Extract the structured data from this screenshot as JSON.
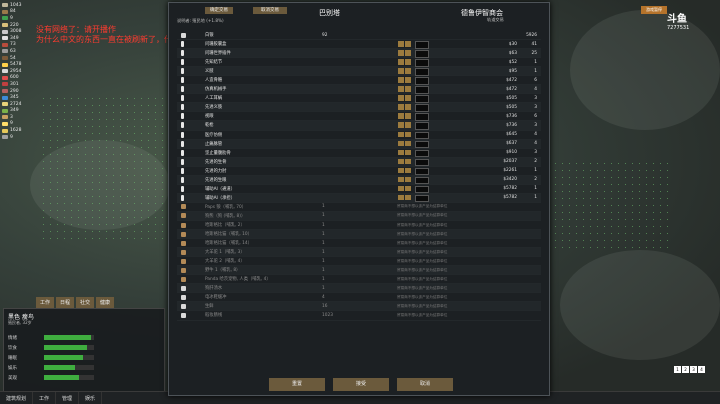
{
  "app": {
    "title": "巴别塔 交易界面"
  },
  "overlay_note": {
    "line1": "没有网络了：请开播作",
    "line2": "为什么中文的东西一直在被刷新了，什么"
  },
  "resources": [
    "1043",
    "84",
    "9",
    "220",
    "3008",
    "349",
    "73",
    "63",
    "54",
    "5478",
    "2954",
    "600",
    "301",
    "290",
    "345",
    "2724",
    "349",
    "3",
    "9",
    "1628",
    "9"
  ],
  "dialog": {
    "btn_left": "确定交易",
    "btn_right": "取消交易",
    "colony_name": "巴别塔",
    "trader_name": "德鲁伊智商会",
    "trader_sub": "轨道交易",
    "info_line": "说明者: 殖民地 (+1.8%)",
    "header_silver": "白银",
    "header_qty_left": "92",
    "header_qty_right": "5926",
    "footer": {
      "reset": "重置",
      "confirm": "接受",
      "cancel": "取消"
    }
  },
  "rows": [
    {
      "name": "问珊胶囊盒",
      "lq": "",
      "price": "$30",
      "rq": "41",
      "type": "gear"
    },
    {
      "name": "问珊世界插件",
      "lq": "",
      "price": "$63",
      "rq": "25",
      "type": "gear"
    },
    {
      "name": "先知结节",
      "lq": "",
      "price": "$52",
      "rq": "1",
      "type": "gear"
    },
    {
      "name": "义肢",
      "lq": "",
      "price": "$95",
      "rq": "1",
      "type": "gear"
    },
    {
      "name": "人造骨骼",
      "lq": "",
      "price": "$472",
      "rq": "6",
      "type": "gear"
    },
    {
      "name": "仿真机械手",
      "lq": "",
      "price": "$472",
      "rq": "4",
      "type": "gear"
    },
    {
      "name": "人工耳蜗",
      "lq": "",
      "price": "$505",
      "rq": "3",
      "type": "gear"
    },
    {
      "name": "先进义肢",
      "lq": "",
      "price": "$505",
      "rq": "3",
      "type": "gear"
    },
    {
      "name": "视眼",
      "lq": "",
      "price": "$736",
      "rq": "6",
      "type": "gear"
    },
    {
      "name": "乾枪",
      "lq": "",
      "price": "$736",
      "rq": "3",
      "type": "gear"
    },
    {
      "name": "医疗仿佣",
      "lq": "",
      "price": "$645",
      "rq": "4",
      "type": "gear"
    },
    {
      "name": "止痛脉管",
      "lq": "",
      "price": "$637",
      "rq": "4",
      "type": "gear"
    },
    {
      "name": "坚止量腹肋骨",
      "lq": "",
      "price": "$910",
      "rq": "3",
      "type": "gear"
    },
    {
      "name": "先进的生骨",
      "lq": "",
      "price": "$2037",
      "rq": "2",
      "type": "gear"
    },
    {
      "name": "先进的力肘",
      "lq": "",
      "price": "$2261",
      "rq": "1",
      "type": "gear"
    },
    {
      "name": "先进的生眼",
      "lq": "",
      "price": "$3420",
      "rq": "2",
      "type": "gear"
    },
    {
      "name": "辅助AI（通道）",
      "lq": "",
      "price": "$5782",
      "rq": "1",
      "type": "gear"
    },
    {
      "name": "辅助AI（承担）",
      "lq": "",
      "price": "$5782",
      "rq": "1",
      "type": "gear"
    },
    {
      "name": "Paps 狼（哺乳, 70）",
      "lq": "1",
      "price": "",
      "rq": "",
      "type": "animal",
      "note": "贸易商不想以该产品为结算单位"
    },
    {
      "name": "狗熊（狗 (哺乳, 8)）",
      "lq": "1",
      "price": "",
      "rq": "",
      "type": "animal",
      "note": "贸易商不想以该产品为结算单位"
    },
    {
      "name": "哈斯格比（哺乳, 2）",
      "lq": "1",
      "price": "",
      "rq": "",
      "type": "animal",
      "note": "贸易商不想以该产品为结算单位"
    },
    {
      "name": "哈斯格比猫（哺乳, 10）",
      "lq": "1",
      "price": "",
      "rq": "",
      "type": "animal",
      "note": "贸易商不想以该产品为结算单位"
    },
    {
      "name": "哈斯格比猫（哺乳, 14）",
      "lq": "1",
      "price": "",
      "rq": "",
      "type": "animal",
      "note": "贸易商不想以该产品为结算单位"
    },
    {
      "name": "大羊驼 1（哺乳, 3）",
      "lq": "1",
      "price": "",
      "rq": "",
      "type": "animal",
      "note": "贸易商不想以该产品为结算单位"
    },
    {
      "name": "大羊驼 2（哺乳, 4）",
      "lq": "1",
      "price": "",
      "rq": "",
      "type": "animal",
      "note": "贸易商不想以该产品为结算单位"
    },
    {
      "name": "野牛 1（哺乳, 8）",
      "lq": "1",
      "price": "",
      "rq": "",
      "type": "animal",
      "note": "贸易商不想以该产品为结算单位"
    },
    {
      "name": "Panda 哈茨宠物, 人类（哺乳, 4）",
      "lq": "1",
      "price": "",
      "rq": "",
      "type": "animal",
      "note": "贸易商不想以该产品为结算单位"
    },
    {
      "name": "狗肝汤水",
      "lq": "1",
      "price": "",
      "rq": "",
      "type": "item",
      "note": "贸易商不想以该产品为结算单位"
    },
    {
      "name": "电冰鞋缓冲",
      "lq": "4",
      "price": "",
      "rq": "",
      "type": "item",
      "note": "贸易商不想以该产品为结算单位"
    },
    {
      "name": "生鲜",
      "lq": "16",
      "price": "",
      "rq": "",
      "type": "item",
      "note": "贸易商不想以该产品为结算单位"
    },
    {
      "name": "稻妆肠线",
      "lq": "1023",
      "price": "",
      "rq": "",
      "type": "item",
      "note": "贸易商不想以该产品为结算单位"
    }
  ],
  "colonist": {
    "name": "黑色 瘦鸟",
    "sub": "殖民者, 32岁",
    "needs": [
      {
        "label": "情绪",
        "v": 0.93
      },
      {
        "label": "饮食",
        "v": 0.85
      },
      {
        "label": "睡眠",
        "v": 0.77
      },
      {
        "label": "娱乐",
        "v": 0.62
      },
      {
        "label": "美观",
        "v": 0.7
      }
    ]
  },
  "bottom_tabs": [
    "工作",
    "日程",
    "社交",
    "健康"
  ],
  "taskbar": [
    "建筑规划",
    "工作",
    "管理",
    "娱乐"
  ],
  "right": {
    "logo": "斗鱼",
    "badge": "7277531",
    "button": "游戏暂停"
  },
  "speed": [
    "1",
    "2",
    "3",
    "4"
  ]
}
